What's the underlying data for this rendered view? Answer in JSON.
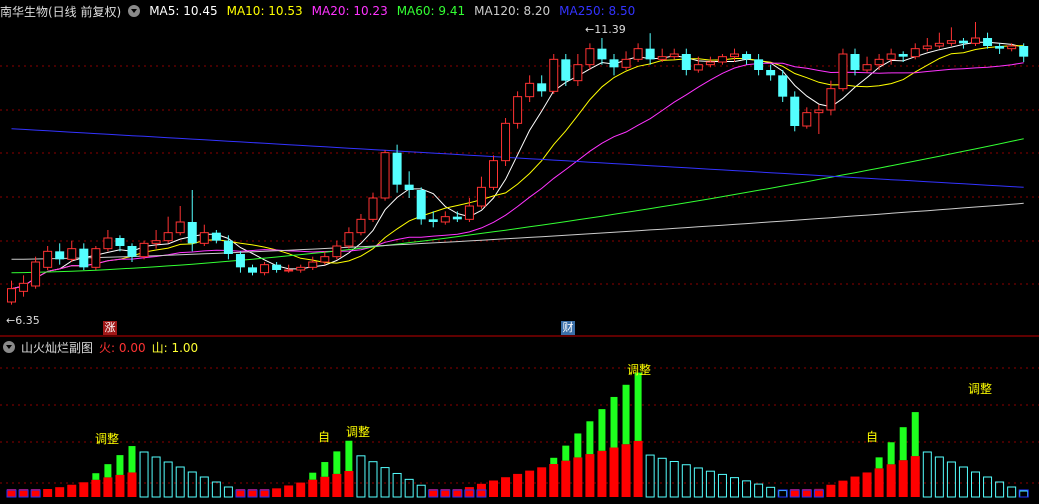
{
  "header": {
    "title": "南华生物(日线 前复权)",
    "ma": [
      {
        "label": "MA5: 10.45",
        "color": "#ffffff"
      },
      {
        "label": "MA10: 10.53",
        "color": "#ffff00"
      },
      {
        "label": "MA20: 10.23",
        "color": "#ff33ff"
      },
      {
        "label": "MA60: 9.41",
        "color": "#33ff33"
      },
      {
        "label": "MA120: 8.20",
        "color": "#cccccc"
      },
      {
        "label": "MA250: 8.50",
        "color": "#3333ff"
      }
    ]
  },
  "main": {
    "high_label": "11.39",
    "low_label": "6.35",
    "badge_zhang": "涨",
    "badge_cai": "财"
  },
  "sub": {
    "title": "山火灿烂副图",
    "huo_label": "火: 0.00",
    "shan_label": "山: 1.00",
    "tags": [
      "调整",
      "调整",
      "调整",
      "调整"
    ],
    "zi_tags": [
      "自",
      "自"
    ]
  },
  "colors": {
    "up": "#ff3333",
    "down": "#54ffff",
    "grid": "#8b0000",
    "bar_red": "#ff0000",
    "bar_green": "#1eff1e",
    "bar_cyan": "#54ffff",
    "bar_blue": "#2233ff"
  },
  "chart_data": {
    "type": "candlestick",
    "candles": [
      [
        6.35,
        6.6,
        6.3,
        6.75
      ],
      [
        6.55,
        6.7,
        6.45,
        6.85
      ],
      [
        6.65,
        7.1,
        6.6,
        7.2
      ],
      [
        7.0,
        7.3,
        6.95,
        7.4
      ],
      [
        7.3,
        7.15,
        7.05,
        7.45
      ],
      [
        7.15,
        7.35,
        7.1,
        7.5
      ],
      [
        7.35,
        7.0,
        6.95,
        7.45
      ],
      [
        7.0,
        7.35,
        6.95,
        7.4
      ],
      [
        7.35,
        7.55,
        7.3,
        7.7
      ],
      [
        7.55,
        7.4,
        7.3,
        7.6
      ],
      [
        7.4,
        7.2,
        7.1,
        7.45
      ],
      [
        7.2,
        7.45,
        7.15,
        7.5
      ],
      [
        7.45,
        7.5,
        7.35,
        7.7
      ],
      [
        7.5,
        7.65,
        7.45,
        7.95
      ],
      [
        7.65,
        7.85,
        7.6,
        8.15
      ],
      [
        7.85,
        7.45,
        7.3,
        8.45
      ],
      [
        7.45,
        7.65,
        7.4,
        7.8
      ],
      [
        7.65,
        7.5,
        7.45,
        7.7
      ],
      [
        7.5,
        7.25,
        7.15,
        7.6
      ],
      [
        7.25,
        7.0,
        6.9,
        7.3
      ],
      [
        7.0,
        6.9,
        6.85,
        7.05
      ],
      [
        6.9,
        7.05,
        6.85,
        7.1
      ],
      [
        7.05,
        6.95,
        6.9,
        7.1
      ],
      [
        6.95,
        6.95,
        6.9,
        7.05
      ],
      [
        6.95,
        7.0,
        6.9,
        7.05
      ],
      [
        7.0,
        7.1,
        6.95,
        7.2
      ],
      [
        7.1,
        7.2,
        7.05,
        7.3
      ],
      [
        7.2,
        7.4,
        7.15,
        7.5
      ],
      [
        7.4,
        7.65,
        7.35,
        7.75
      ],
      [
        7.65,
        7.9,
        7.6,
        8.0
      ],
      [
        7.9,
        8.3,
        7.85,
        8.4
      ],
      [
        8.3,
        9.15,
        8.25,
        9.2
      ],
      [
        9.15,
        8.55,
        8.4,
        9.3
      ],
      [
        8.55,
        8.45,
        8.3,
        8.8
      ],
      [
        8.45,
        7.9,
        7.8,
        8.5
      ],
      [
        7.9,
        7.85,
        7.75,
        8.05
      ],
      [
        7.85,
        7.95,
        7.8,
        8.05
      ],
      [
        7.95,
        7.9,
        7.85,
        8.05
      ],
      [
        7.9,
        8.15,
        7.85,
        8.3
      ],
      [
        8.15,
        8.5,
        8.1,
        8.7
      ],
      [
        8.5,
        9.0,
        8.45,
        9.1
      ],
      [
        9.0,
        9.7,
        8.9,
        9.8
      ],
      [
        9.7,
        10.2,
        9.6,
        10.3
      ],
      [
        10.2,
        10.45,
        10.1,
        10.6
      ],
      [
        10.45,
        10.3,
        10.2,
        10.6
      ],
      [
        10.3,
        10.9,
        10.25,
        11.0
      ],
      [
        10.9,
        10.5,
        10.4,
        11.0
      ],
      [
        10.5,
        10.8,
        10.4,
        11.0
      ],
      [
        10.8,
        11.1,
        10.7,
        11.2
      ],
      [
        11.1,
        10.9,
        10.8,
        11.3
      ],
      [
        10.9,
        10.75,
        10.6,
        11.0
      ],
      [
        10.75,
        10.9,
        10.7,
        11.05
      ],
      [
        10.9,
        11.1,
        10.85,
        11.2
      ],
      [
        11.1,
        10.9,
        10.8,
        11.39
      ],
      [
        10.9,
        10.95,
        10.85,
        11.1
      ],
      [
        10.95,
        11.0,
        10.9,
        11.1
      ],
      [
        11.0,
        10.7,
        10.6,
        11.1
      ],
      [
        10.7,
        10.8,
        10.65,
        10.95
      ],
      [
        10.8,
        10.85,
        10.75,
        10.95
      ],
      [
        10.85,
        10.95,
        10.8,
        11.0
      ],
      [
        10.95,
        11.0,
        10.85,
        11.1
      ],
      [
        11.0,
        10.9,
        10.8,
        11.05
      ],
      [
        10.9,
        10.7,
        10.6,
        11.0
      ],
      [
        10.7,
        10.6,
        10.5,
        10.8
      ],
      [
        10.6,
        10.2,
        10.1,
        10.7
      ],
      [
        10.2,
        9.65,
        9.55,
        10.3
      ],
      [
        9.65,
        9.9,
        9.6,
        10.0
      ],
      [
        9.9,
        9.95,
        9.5,
        10.05
      ],
      [
        9.95,
        10.35,
        9.85,
        10.5
      ],
      [
        10.35,
        11.0,
        10.3,
        11.1
      ],
      [
        11.0,
        10.7,
        10.6,
        11.1
      ],
      [
        10.7,
        10.8,
        10.65,
        10.95
      ],
      [
        10.8,
        10.9,
        10.7,
        11.0
      ],
      [
        10.9,
        11.0,
        10.8,
        11.1
      ],
      [
        11.0,
        10.95,
        10.85,
        11.05
      ],
      [
        10.95,
        11.1,
        10.9,
        11.2
      ],
      [
        11.1,
        11.15,
        11.05,
        11.3
      ],
      [
        11.15,
        11.2,
        11.1,
        11.4
      ],
      [
        11.2,
        11.25,
        11.15,
        11.5
      ],
      [
        11.25,
        11.2,
        11.1,
        11.3
      ],
      [
        11.2,
        11.3,
        11.15,
        11.6
      ],
      [
        11.3,
        11.15,
        11.1,
        11.4
      ],
      [
        11.15,
        11.1,
        11.0,
        11.2
      ],
      [
        11.1,
        11.15,
        11.05,
        11.2
      ],
      [
        11.15,
        10.95,
        10.85,
        11.2
      ]
    ],
    "ylim": [
      6.2,
      11.6
    ]
  }
}
